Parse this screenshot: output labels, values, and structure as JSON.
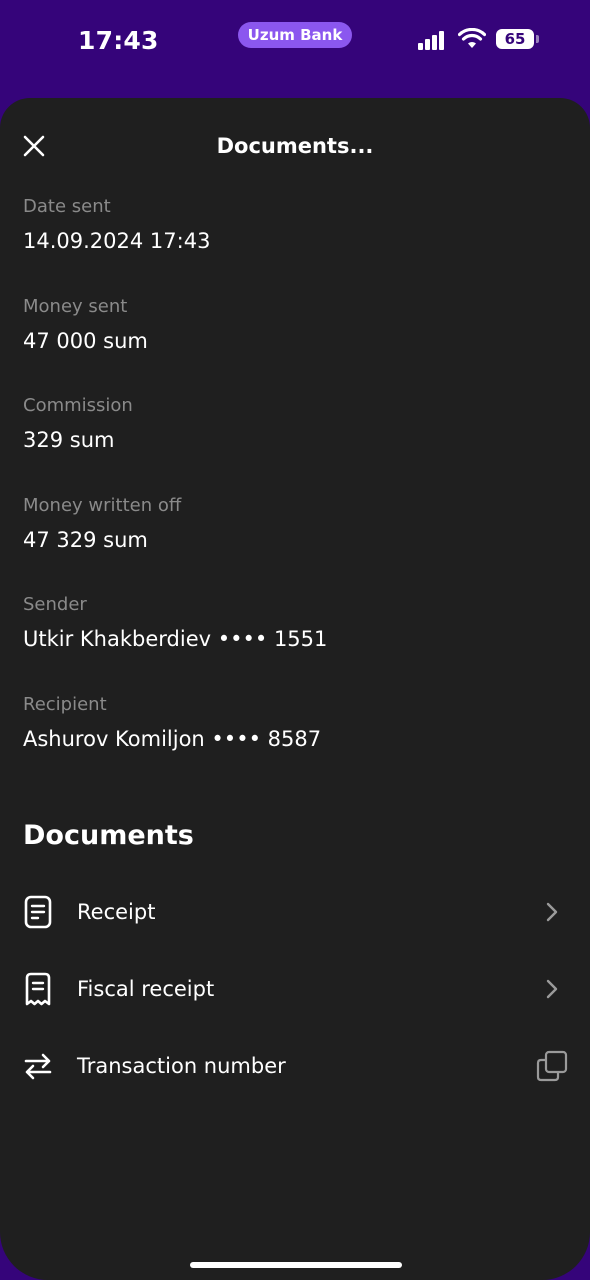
{
  "status_bar": {
    "time": "17:43",
    "app_name": "Uzum Bank",
    "battery": "65",
    "accent_color": "#8b57ef"
  },
  "header": {
    "title": "Documents...",
    "close_icon": "close-icon"
  },
  "details": {
    "date_sent": {
      "label": "Date sent",
      "value": "14.09.2024 17:43"
    },
    "money_sent": {
      "label": "Money sent",
      "value": "47 000 sum"
    },
    "commission": {
      "label": "Commission",
      "value": "329 sum"
    },
    "money_written_off": {
      "label": "Money written off",
      "value": "47 329 sum"
    },
    "sender": {
      "label": "Sender",
      "value": "Utkir Khakberdiev •••• 1551"
    },
    "recipient": {
      "label": "Recipient",
      "value": "Ashurov Komiljon •••• 8587"
    }
  },
  "documents": {
    "title": "Documents",
    "items": [
      {
        "label": "Receipt",
        "icon": "document-icon",
        "action_icon": "chevron-right-icon"
      },
      {
        "label": "Fiscal receipt",
        "icon": "fiscal-receipt-icon",
        "action_icon": "chevron-right-icon"
      },
      {
        "label": "Transaction number",
        "icon": "transfer-arrows-icon",
        "action_icon": "copy-icon"
      }
    ]
  },
  "colors": {
    "background": "#35047a",
    "sheet": "#1f1f1f",
    "label": "#8a8a8a"
  }
}
